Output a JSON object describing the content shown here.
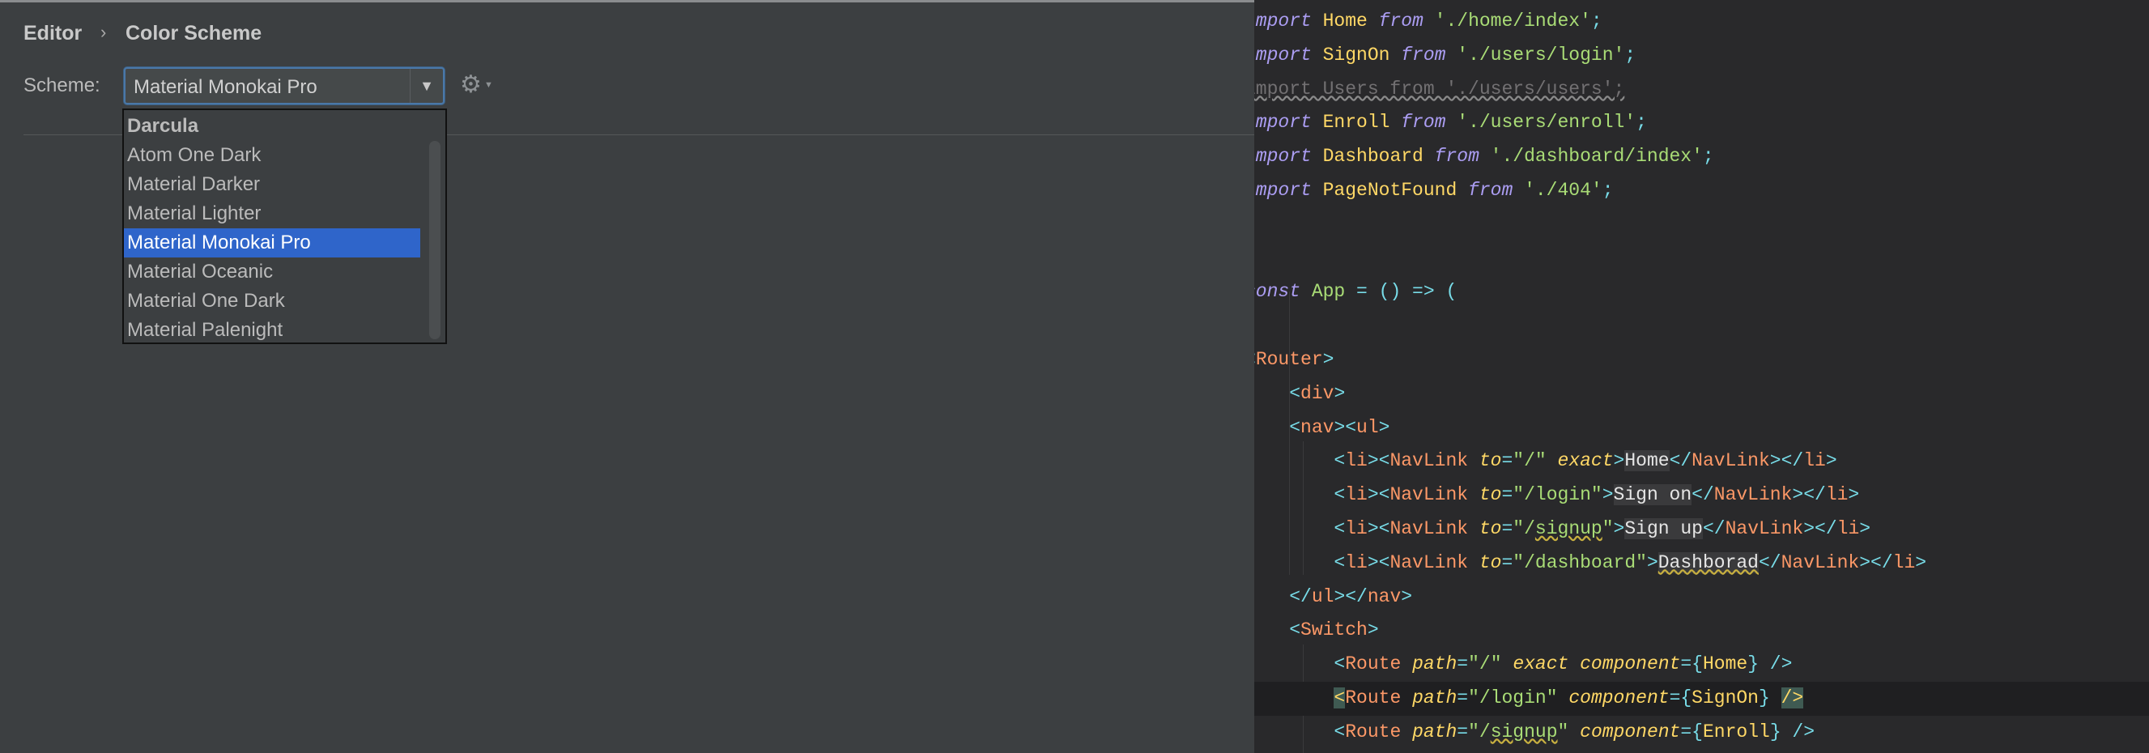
{
  "settings": {
    "breadcrumb": [
      "Editor",
      "Color Scheme"
    ],
    "breadcrumb_separator": "›",
    "scheme_label": "Scheme:",
    "scheme_value": "Material Monokai Pro",
    "dropdown_arrow": "▼",
    "gear_icon": "⚙",
    "gear_caret": "▼",
    "options": [
      {
        "label": "Darcula",
        "bold": true
      },
      {
        "label": "Atom One Dark"
      },
      {
        "label": "Material Darker"
      },
      {
        "label": "Material Lighter"
      },
      {
        "label": "Material Monokai Pro",
        "selected": true
      },
      {
        "label": "Material Oceanic"
      },
      {
        "label": "Material One Dark"
      },
      {
        "label": "Material Palenight"
      }
    ],
    "colors": {
      "panel_bg": "#3c3f41",
      "selection": "#2f65ca",
      "focus_border": "#4a78a8"
    }
  },
  "editor": {
    "colors": {
      "bg": "#29292b",
      "keyword": "#ab9df2",
      "class": "#ffd866",
      "string": "#a9dc76",
      "punctuation": "#78dce8",
      "tag": "#fc9867"
    },
    "current_line": 20,
    "lines": [
      [
        [
          "import ",
          "kw"
        ],
        [
          "Home ",
          "cls"
        ],
        [
          "from ",
          "kw"
        ],
        [
          "'./home/index'",
          "str"
        ],
        [
          ";",
          "pun"
        ]
      ],
      [
        [
          "import ",
          "kw"
        ],
        [
          "SignOn ",
          "cls"
        ],
        [
          "from ",
          "kw"
        ],
        [
          "'./users/login'",
          "str"
        ],
        [
          ";",
          "pun"
        ]
      ],
      [
        [
          "import Users from './users/users';",
          "dim"
        ]
      ],
      [
        [
          "import ",
          "kw"
        ],
        [
          "Enroll ",
          "cls"
        ],
        [
          "from ",
          "kw"
        ],
        [
          "'./users/enroll'",
          "str"
        ],
        [
          ";",
          "pun"
        ]
      ],
      [
        [
          "import ",
          "kw"
        ],
        [
          "Dashboard ",
          "cls"
        ],
        [
          "from ",
          "kw"
        ],
        [
          "'./dashboard/index'",
          "str"
        ],
        [
          ";",
          "pun"
        ]
      ],
      [
        [
          "import ",
          "kw"
        ],
        [
          "PageNotFound ",
          "cls"
        ],
        [
          "from ",
          "kw"
        ],
        [
          "'./404'",
          "str"
        ],
        [
          ";",
          "pun"
        ]
      ],
      [],
      [],
      [
        [
          "const ",
          "kw"
        ],
        [
          "App ",
          "str"
        ],
        [
          "= () => (",
          "pun"
        ]
      ],
      [],
      [
        [
          "<",
          "pun"
        ],
        [
          "Router",
          "tag"
        ],
        [
          ">",
          "pun"
        ]
      ],
      [
        [
          "    <",
          "pun"
        ],
        [
          "div",
          "tag"
        ],
        [
          ">",
          "pun"
        ]
      ],
      [
        [
          "    <",
          "pun"
        ],
        [
          "nav",
          "tag"
        ],
        [
          "><",
          "pun"
        ],
        [
          "ul",
          "tag"
        ],
        [
          ">",
          "pun"
        ]
      ],
      [
        [
          "        <",
          "pun"
        ],
        [
          "li",
          "tag"
        ],
        [
          "><",
          "pun"
        ],
        [
          "NavLink ",
          "tag"
        ],
        [
          "to",
          "attr"
        ],
        [
          "=",
          "pun"
        ],
        [
          "\"/\" ",
          "str"
        ],
        [
          "exact",
          "attr"
        ],
        [
          ">",
          "pun"
        ],
        [
          "Home",
          "hl"
        ],
        [
          "</",
          "pun"
        ],
        [
          "NavLink",
          "tag"
        ],
        [
          "></",
          "pun"
        ],
        [
          "li",
          "tag"
        ],
        [
          ">",
          "pun"
        ]
      ],
      [
        [
          "        <",
          "pun"
        ],
        [
          "li",
          "tag"
        ],
        [
          "><",
          "pun"
        ],
        [
          "NavLink ",
          "tag"
        ],
        [
          "to",
          "attr"
        ],
        [
          "=",
          "pun"
        ],
        [
          "\"/login\"",
          "str"
        ],
        [
          ">",
          "pun"
        ],
        [
          "Sign on",
          "hl"
        ],
        [
          "</",
          "pun"
        ],
        [
          "NavLink",
          "tag"
        ],
        [
          "></",
          "pun"
        ],
        [
          "li",
          "tag"
        ],
        [
          ">",
          "pun"
        ]
      ],
      [
        [
          "        <",
          "pun"
        ],
        [
          "li",
          "tag"
        ],
        [
          "><",
          "pun"
        ],
        [
          "NavLink ",
          "tag"
        ],
        [
          "to",
          "attr"
        ],
        [
          "=",
          "pun"
        ],
        [
          "\"/",
          "str"
        ],
        [
          "signup",
          "str wavy"
        ],
        [
          "\"",
          "str"
        ],
        [
          ">",
          "pun"
        ],
        [
          "Sign up",
          "hl"
        ],
        [
          "</",
          "pun"
        ],
        [
          "NavLink",
          "tag"
        ],
        [
          "></",
          "pun"
        ],
        [
          "li",
          "tag"
        ],
        [
          ">",
          "pun"
        ]
      ],
      [
        [
          "        <",
          "pun"
        ],
        [
          "li",
          "tag"
        ],
        [
          "><",
          "pun"
        ],
        [
          "NavLink ",
          "tag"
        ],
        [
          "to",
          "attr"
        ],
        [
          "=",
          "pun"
        ],
        [
          "\"/dashboard\"",
          "str"
        ],
        [
          ">",
          "pun"
        ],
        [
          "Dashborad",
          "hl wavy"
        ],
        [
          "</",
          "pun"
        ],
        [
          "NavLink",
          "tag"
        ],
        [
          "></",
          "pun"
        ],
        [
          "li",
          "tag"
        ],
        [
          ">",
          "pun"
        ]
      ],
      [
        [
          "    </",
          "pun"
        ],
        [
          "ul",
          "tag"
        ],
        [
          "></",
          "pun"
        ],
        [
          "nav",
          "tag"
        ],
        [
          ">",
          "pun"
        ]
      ],
      [
        [
          "    <",
          "pun"
        ],
        [
          "Switch",
          "tag"
        ],
        [
          ">",
          "pun"
        ]
      ],
      [
        [
          "        <",
          "pun"
        ],
        [
          "Route ",
          "tag"
        ],
        [
          "path",
          "attr"
        ],
        [
          "=",
          "pun"
        ],
        [
          "\"/\" ",
          "str"
        ],
        [
          "exact component",
          "attr"
        ],
        [
          "={",
          "pun"
        ],
        [
          "Home",
          "cls"
        ],
        [
          "} />",
          "pun"
        ]
      ],
      [
        [
          "        ",
          "txt"
        ],
        [
          "<",
          "match"
        ],
        [
          "Route ",
          "tag"
        ],
        [
          "path",
          "attr"
        ],
        [
          "=",
          "pun"
        ],
        [
          "\"/login\" ",
          "str"
        ],
        [
          "component",
          "attr"
        ],
        [
          "={",
          "pun"
        ],
        [
          "SignOn",
          "cls"
        ],
        [
          "} ",
          "pun"
        ],
        [
          "/>",
          "match"
        ]
      ],
      [
        [
          "        <",
          "pun"
        ],
        [
          "Route ",
          "tag"
        ],
        [
          "path",
          "attr"
        ],
        [
          "=",
          "pun"
        ],
        [
          "\"/",
          "str"
        ],
        [
          "signup",
          "str wavy"
        ],
        [
          "\" ",
          "str"
        ],
        [
          "component",
          "attr"
        ],
        [
          "={",
          "pun"
        ],
        [
          "Enroll",
          "cls"
        ],
        [
          "} />",
          "pun"
        ]
      ]
    ]
  }
}
